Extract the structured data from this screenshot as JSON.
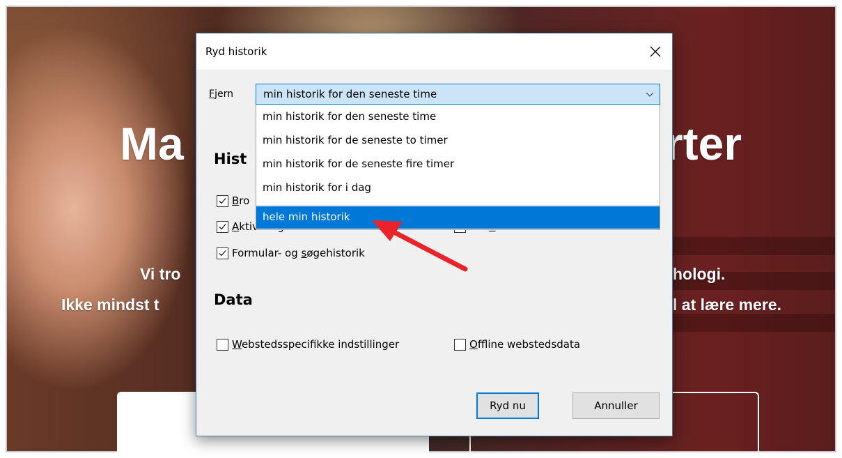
{
  "background": {
    "heading_left": "Ma",
    "heading_right": "rter",
    "line1_left": "Vi tro",
    "line1_right": "hologi.",
    "line2_left": "Ikke mindst t",
    "line2_right": "l at lære mere."
  },
  "dialog": {
    "title": "Ryd historik",
    "fjern_label_accel": "F",
    "fjern_label_rest": "jern",
    "selected_value": "min historik for den seneste time",
    "options": [
      "min historik for den seneste time",
      "min historik for de seneste to timer",
      "min historik for de seneste fire timer",
      "min historik for i dag",
      "hele min historik"
    ],
    "history_section_partial": "Hist",
    "history_checkboxes": [
      {
        "label_pre": "",
        "accel": "B",
        "label_post": "ro",
        "checked": true
      },
      {
        "label_pre": "",
        "accel": "A",
        "label_post": "ktive logins",
        "checked": true
      },
      {
        "label_pre": "Formular- og ",
        "accel": "s",
        "label_post": "øgehistorik",
        "checked": true
      },
      {
        "label_pre": "Cac",
        "accel": "h",
        "label_post": "e",
        "checked": false
      }
    ],
    "data_section": "Data",
    "data_checkboxes": [
      {
        "label_pre": "",
        "accel": "W",
        "label_post": "ebstedsspecifikke indstillinger",
        "checked": false
      },
      {
        "label_pre": "",
        "accel": "O",
        "label_post": "ffline webstedsdata",
        "checked": false
      }
    ],
    "clear_button": "Ryd nu",
    "cancel_button": "Annuller"
  },
  "colors": {
    "selection": "#0078d7",
    "select_bg": "#cce4f7",
    "arrow": "#e8232a"
  }
}
